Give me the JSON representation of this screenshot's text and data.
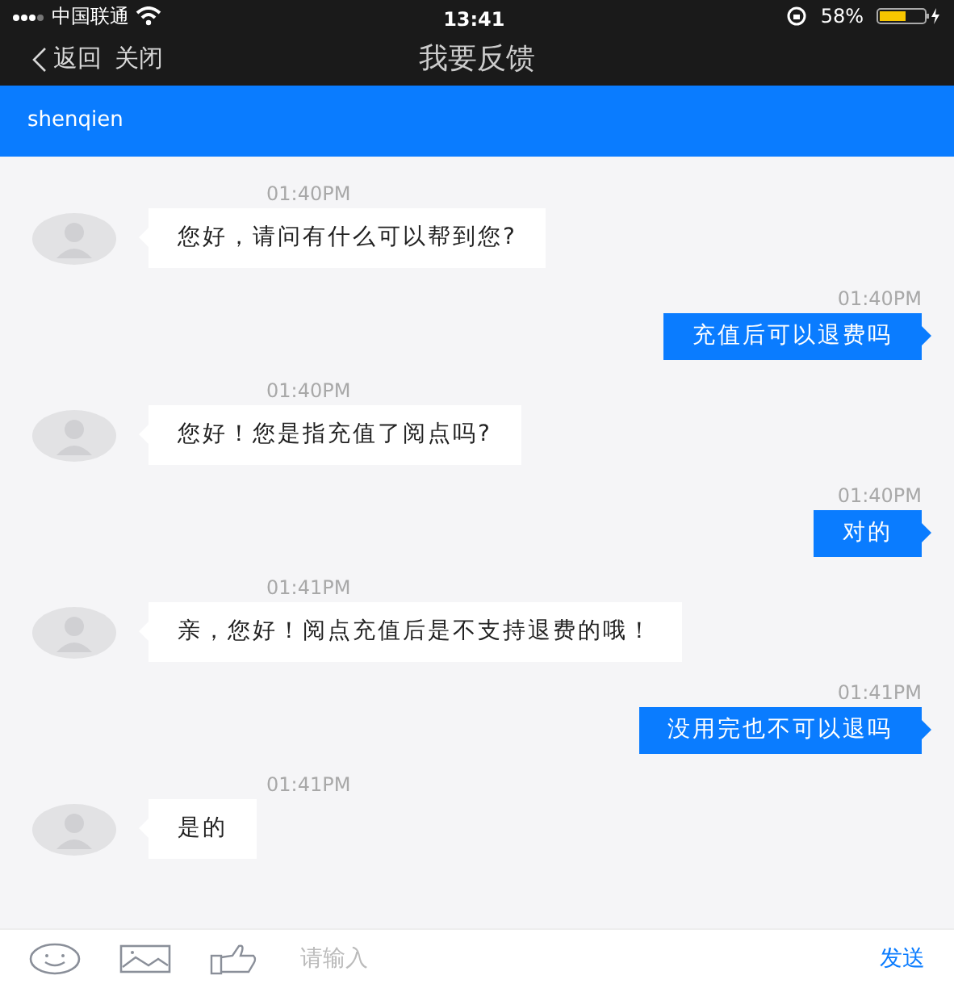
{
  "status_bar": {
    "carrier": "中国联通",
    "time": "13:41",
    "battery": "58%"
  },
  "nav": {
    "back": "返回",
    "close": "关闭",
    "title": "我要反馈"
  },
  "contact": {
    "name": "shenqien"
  },
  "messages": [
    {
      "kind": "agent",
      "time": "01:40PM",
      "text": "您好，请问有什么可以帮到您?"
    },
    {
      "kind": "user",
      "time": "01:40PM",
      "text": "充值后可以退费吗"
    },
    {
      "kind": "agent",
      "time": "01:40PM",
      "text": "您好！您是指充值了阅点吗?"
    },
    {
      "kind": "user",
      "time": "01:40PM",
      "text": "对的"
    },
    {
      "kind": "agent",
      "time": "01:41PM",
      "text": "亲，您好！阅点充值后是不支持退费的哦！"
    },
    {
      "kind": "user",
      "time": "01:41PM",
      "text": "没用完也不可以退吗"
    },
    {
      "kind": "agent",
      "time": "01:41PM",
      "text": "是的"
    }
  ],
  "composer": {
    "placeholder": "请输入",
    "send": "发送"
  }
}
